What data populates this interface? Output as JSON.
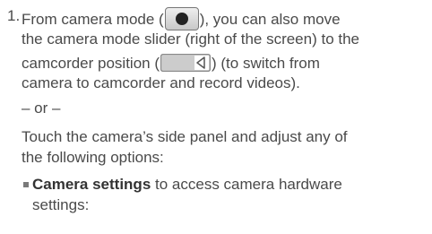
{
  "step1": {
    "number": "1.",
    "line1_before": "From camera mode (",
    "line1_after": "), you can also move",
    "line2": "the camera mode slider (right of the screen) to the",
    "line3_before": "camcorder position (",
    "line3_after": ") (to switch from",
    "line4": "camera to camcorder and record videos)."
  },
  "or_separator": "– or –",
  "alt_text": {
    "line1": "Touch the camera’s side panel and adjust any of",
    "line2": "the following options:"
  },
  "bullet_item": {
    "bold_label": "Camera settings",
    "rest_line1": " to access camera hardware",
    "line2": "settings:"
  },
  "icons": {
    "camera_button": "camera-shutter-icon",
    "camcorder_slider": "camcorder-slider-icon"
  }
}
